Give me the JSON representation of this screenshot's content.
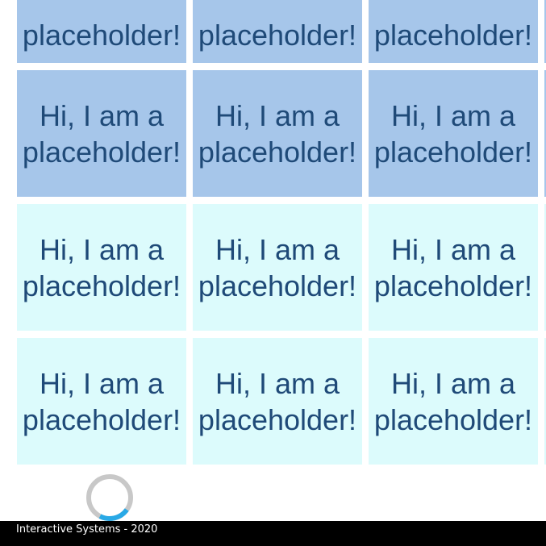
{
  "tiles": {
    "line1": "Hi, I am a",
    "line2": "placeholder!"
  },
  "rows": [
    {
      "color": "blue",
      "partial": true
    },
    {
      "color": "blue",
      "partial": false
    },
    {
      "color": "cyan",
      "partial": false
    },
    {
      "color": "cyan",
      "partial": false
    }
  ],
  "colors": {
    "tile_blue": "#a6c6ea",
    "tile_cyan": "#dcfbfc",
    "tile_text": "#1f4a78",
    "spinner_track": "#c8c8c8",
    "spinner_accent": "#29a9e6",
    "footer_bg": "#000000"
  },
  "footer": {
    "text": "Interactive Systems - 2020"
  },
  "spinner": {
    "icon": "loading-spinner-icon"
  }
}
